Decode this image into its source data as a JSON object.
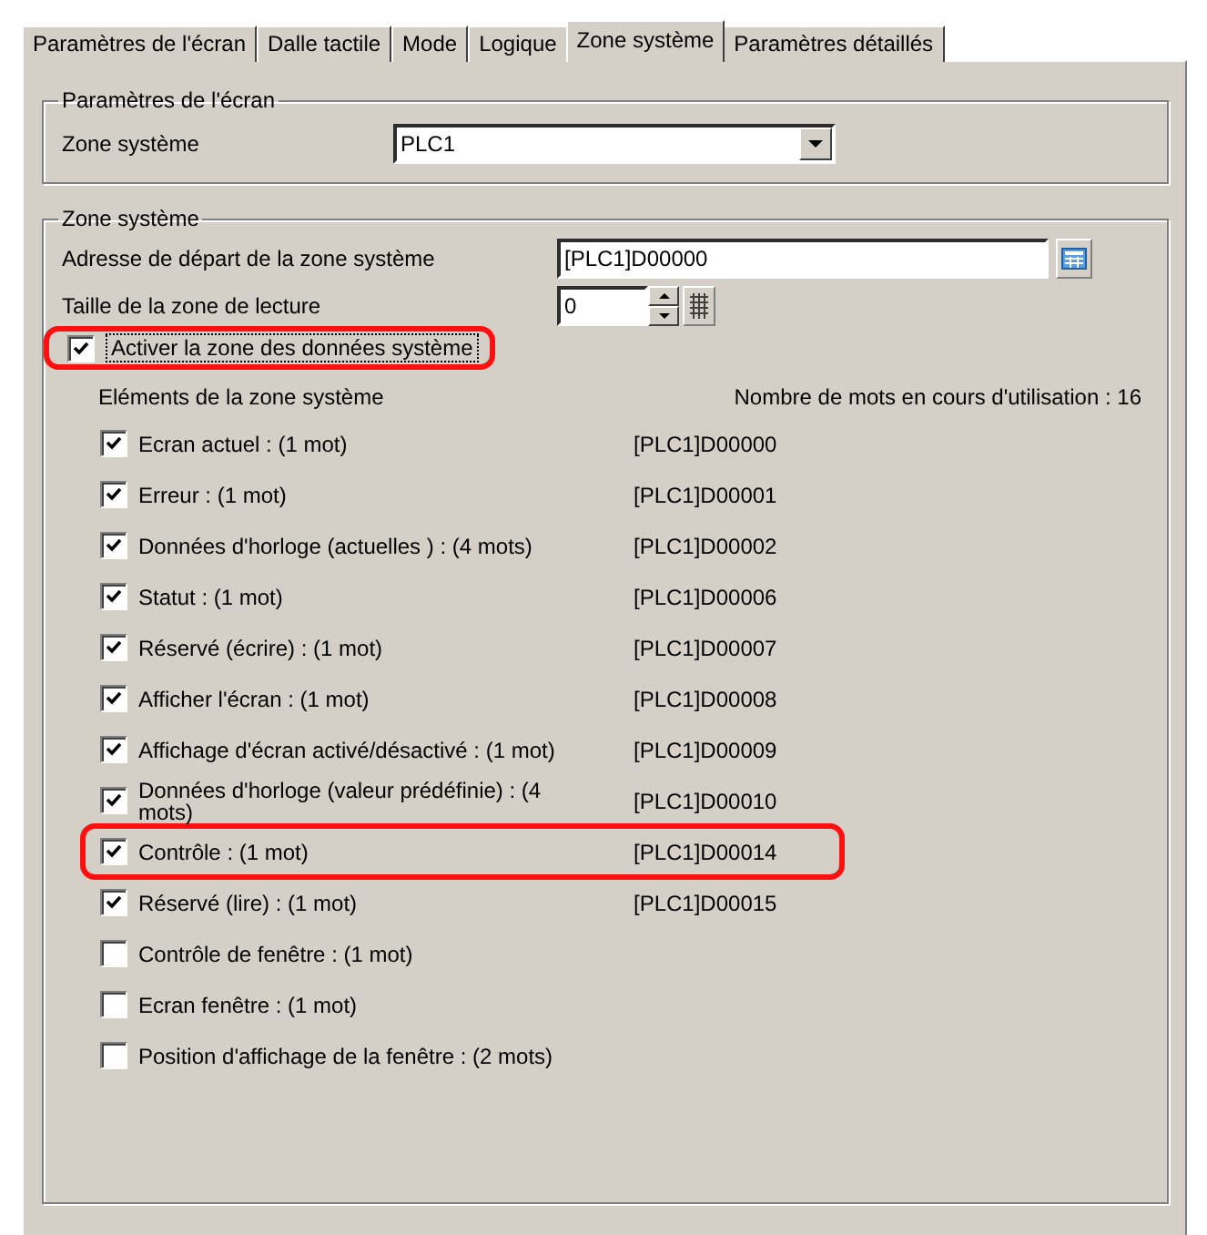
{
  "tabs": [
    {
      "label": "Paramètres de l'écran",
      "selected": false
    },
    {
      "label": "Dalle tactile",
      "selected": false
    },
    {
      "label": "Mode",
      "selected": false
    },
    {
      "label": "Logique",
      "selected": false
    },
    {
      "label": "Zone système",
      "selected": true
    },
    {
      "label": "Paramètres détaillés",
      "selected": false
    }
  ],
  "screen_settings": {
    "title": "Paramètres de l'écran",
    "label": "Zone système",
    "value": "PLC1"
  },
  "system_zone": {
    "title": "Zone système",
    "start_address": {
      "label": "Adresse de départ de la zone système",
      "value": "[PLC1]D00000"
    },
    "read_size": {
      "label": "Taille de la zone de lecture",
      "value": "0"
    },
    "enable": {
      "label": "Activer la zone des données système",
      "checked": true,
      "highlighted": true
    },
    "items_heading": "Eléments de la zone système",
    "words_in_use": "Nombre de mots en cours d'utilisation : 16",
    "items": [
      {
        "label": "Ecran actuel : (1 mot)",
        "address": "[PLC1]D00000",
        "checked": true,
        "highlighted": false
      },
      {
        "label": "Erreur : (1 mot)",
        "address": "[PLC1]D00001",
        "checked": true,
        "highlighted": false
      },
      {
        "label": "Données d'horloge (actuelles ) : (4 mots)",
        "address": "[PLC1]D00002",
        "checked": true,
        "highlighted": false
      },
      {
        "label": "Statut : (1 mot)",
        "address": "[PLC1]D00006",
        "checked": true,
        "highlighted": false
      },
      {
        "label": "Réservé (écrire) : (1 mot)",
        "address": "[PLC1]D00007",
        "checked": true,
        "highlighted": false
      },
      {
        "label": "Afficher l'écran : (1 mot)",
        "address": "[PLC1]D00008",
        "checked": true,
        "highlighted": false
      },
      {
        "label": "Affichage d'écran activé/désactivé : (1 mot)",
        "address": "[PLC1]D00009",
        "checked": true,
        "highlighted": false
      },
      {
        "label": "Données d'horloge (valeur prédéfinie) : (4 mots)",
        "address": "[PLC1]D00010",
        "checked": true,
        "highlighted": false
      },
      {
        "label": "Contrôle : (1 mot)",
        "address": "[PLC1]D00014",
        "checked": true,
        "highlighted": true
      },
      {
        "label": "Réservé (lire) : (1 mot)",
        "address": "[PLC1]D00015",
        "checked": true,
        "highlighted": false
      },
      {
        "label": "Contrôle de fenêtre : (1 mot)",
        "checked": false,
        "highlighted": false
      },
      {
        "label": "Ecran fenêtre : (1 mot)",
        "checked": false,
        "highlighted": false
      },
      {
        "label": "Position d'affichage de la fenêtre : (2 mots)",
        "checked": false,
        "highlighted": false
      }
    ]
  }
}
